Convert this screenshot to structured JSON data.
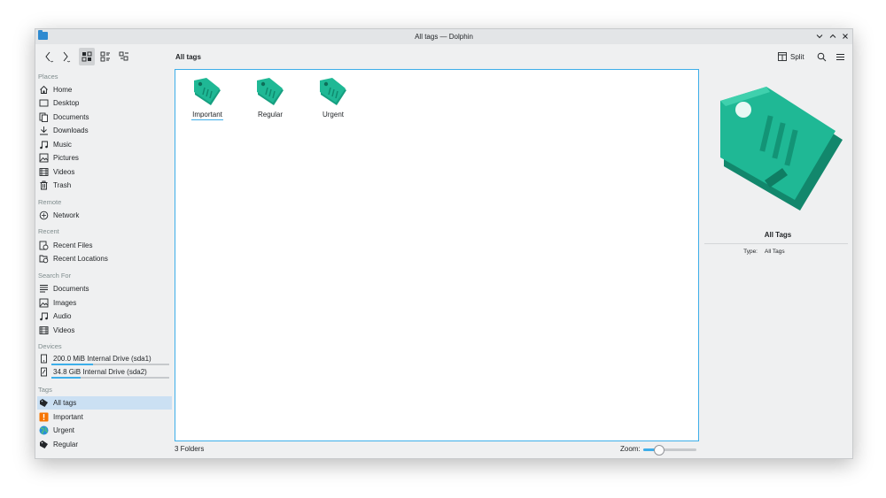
{
  "window": {
    "title": "All tags — Dolphin"
  },
  "toolbar": {
    "location": "All tags",
    "split_label": "Split"
  },
  "sidebar": {
    "sections": {
      "places": "Places",
      "remote": "Remote",
      "recent": "Recent",
      "search_for": "Search For",
      "devices": "Devices",
      "tags": "Tags"
    },
    "places": [
      {
        "label": "Home",
        "icon": "home-icon"
      },
      {
        "label": "Desktop",
        "icon": "desktop-icon"
      },
      {
        "label": "Documents",
        "icon": "documents-icon"
      },
      {
        "label": "Downloads",
        "icon": "downloads-icon"
      },
      {
        "label": "Music",
        "icon": "music-icon"
      },
      {
        "label": "Pictures",
        "icon": "pictures-icon"
      },
      {
        "label": "Videos",
        "icon": "videos-icon"
      },
      {
        "label": "Trash",
        "icon": "trash-icon"
      }
    ],
    "remote": [
      {
        "label": "Network",
        "icon": "network-icon"
      }
    ],
    "recent": [
      {
        "label": "Recent Files",
        "icon": "recent-files-icon"
      },
      {
        "label": "Recent Locations",
        "icon": "recent-locations-icon"
      }
    ],
    "search_for": [
      {
        "label": "Documents",
        "icon": "documents-icon"
      },
      {
        "label": "Images",
        "icon": "images-icon"
      },
      {
        "label": "Audio",
        "icon": "audio-icon"
      },
      {
        "label": "Videos",
        "icon": "videos-icon"
      }
    ],
    "devices": [
      {
        "label": "200.0 MiB Internal Drive (sda1)",
        "icon": "drive-icon",
        "usage": 0.35
      },
      {
        "label": "34.8 GiB Internal Drive (sda2)",
        "icon": "drive-icon",
        "usage": 0.25
      }
    ],
    "tags": [
      {
        "label": "All tags",
        "icon": "tag-icon",
        "selected": true
      },
      {
        "label": "Important",
        "icon": "important-icon"
      },
      {
        "label": "Urgent",
        "icon": "globe-icon"
      },
      {
        "label": "Regular",
        "icon": "tag-icon"
      }
    ]
  },
  "main": {
    "items": [
      {
        "name": "Important",
        "hovered": true
      },
      {
        "name": "Regular"
      },
      {
        "name": "Urgent"
      }
    ]
  },
  "status": {
    "summary": "3 Folders",
    "zoom_label": "Zoom:",
    "zoom_level": 0.3
  },
  "info_panel": {
    "name": "All Tags",
    "type_key": "Type:",
    "type_value": "All Tags"
  },
  "colors": {
    "accent": "#3daee9",
    "tag": "#1fb895",
    "selection": "#cbe0f3"
  }
}
